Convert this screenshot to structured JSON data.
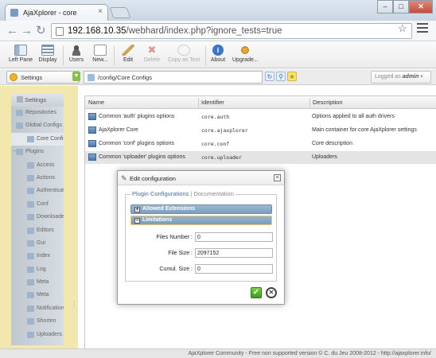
{
  "browser": {
    "tab_title": "AjaXplorer - core",
    "tab_close": "×",
    "window_buttons": {
      "minimize": "–",
      "restore": "□",
      "close": "✕"
    },
    "url_host": "192.168.10.35",
    "url_path": "/webhard/index.php?ignore_tests=true",
    "icons": {
      "back": "arrow-left",
      "forward": "arrow-right",
      "reload": "reload",
      "page": "page",
      "star": "star",
      "menu": "menu"
    }
  },
  "toolbar": {
    "left_pane": "Left Pane",
    "display": "Display",
    "users": "Users",
    "new": "New...",
    "edit": "Edit",
    "delete": "Delete",
    "copy_as_text": "Copy as Text",
    "about": "About",
    "upgrade": "Upgrade..."
  },
  "location": {
    "repository": "Settings",
    "path": "/config/Core Configs",
    "logged_as_prefix": "Logged as",
    "logged_as_user": "admin"
  },
  "tree": {
    "header": "Settings",
    "items": [
      {
        "label": "Repositories",
        "level": 0
      },
      {
        "label": "Global Configs",
        "level": 0
      },
      {
        "label": "Core Configs",
        "level": 1,
        "selected": true
      },
      {
        "label": "Plugins",
        "level": 0,
        "expander": "−"
      },
      {
        "label": "Access",
        "level": 1
      },
      {
        "label": "Actions",
        "level": 1
      },
      {
        "label": "Authentication",
        "level": 1
      },
      {
        "label": "Conf",
        "level": 1
      },
      {
        "label": "Downloaders",
        "level": 1
      },
      {
        "label": "Editors",
        "level": 1
      },
      {
        "label": "Gui",
        "level": 1
      },
      {
        "label": "Index",
        "level": 1
      },
      {
        "label": "Log",
        "level": 1
      },
      {
        "label": "Meta",
        "level": 1
      },
      {
        "label": "Meta",
        "level": 1
      },
      {
        "label": "Notifications",
        "level": 1
      },
      {
        "label": "Shorten",
        "level": 1
      },
      {
        "label": "Uploaders",
        "level": 1
      }
    ]
  },
  "list": {
    "columns": [
      "Name",
      "Identifier",
      "Description"
    ],
    "rows": [
      {
        "name": "Common 'auth' plugins options",
        "id": "core.auth",
        "desc": "Options applied to all auth drivers"
      },
      {
        "name": "AjaXplorer Core",
        "id": "core.ajaxplorer",
        "desc": "Main container for core AjaXplorer settings"
      },
      {
        "name": "Common 'conf' plugins options",
        "id": "core.conf",
        "desc": "Core description"
      },
      {
        "name": "Common 'uploader' plugins options",
        "id": "core.uploader",
        "desc": "Uploaders",
        "selected": true
      }
    ]
  },
  "modal": {
    "title": "Edit configuration",
    "close": "×",
    "legend_active": "Plugin Configurations",
    "legend_separator": "|",
    "legend_inactive": "Documentation",
    "sections": [
      {
        "label": "Allowed Extensions",
        "toggle": "+"
      },
      {
        "label": "Limitations",
        "toggle": "−"
      }
    ],
    "fields": [
      {
        "label": "Files Number :",
        "value": "0"
      },
      {
        "label": "File Size :",
        "value": "2097152"
      },
      {
        "label": "Cumul. Size :",
        "value": "0"
      }
    ],
    "ok": "✓",
    "cancel": "✕"
  },
  "status": "AjaXplorer Community - Free non supported version © C. du Jeu 2008-2012 - http://ajaxplorer.info/",
  "colors": {
    "accent_blue": "#3a6ea5",
    "left_pane_bg": "#f3e7b0",
    "ok_green": "#3d9a1c"
  }
}
